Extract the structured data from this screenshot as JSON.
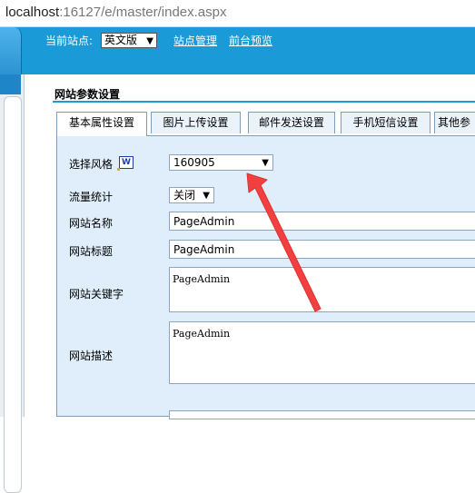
{
  "browser": {
    "host": "localhost",
    "path": ":16127/e/master/index.aspx"
  },
  "topbar": {
    "site_label": "当前站点:",
    "site_value": "英文版",
    "links": [
      "站点管理",
      "前台预览"
    ]
  },
  "panel": {
    "title": "网站参数设置",
    "tabs": [
      "基本属性设置",
      "图片上传设置",
      "邮件发送设置",
      "手机短信设置",
      "其他参"
    ]
  },
  "form": {
    "style_label": "选择风格",
    "style_value": "160905",
    "traffic_label": "流量统计",
    "traffic_value": "关闭",
    "name_label": "网站名称",
    "name_value": "PageAdmin",
    "title_label": "网站标题",
    "title_value": "PageAdmin",
    "keywords_label": "网站关键字",
    "keywords_value": "PageAdmin",
    "desc_label": "网站描述",
    "desc_value": "PageAdmin"
  },
  "colors": {
    "banner": "#1a9ad6",
    "content_bg": "#dfeefa",
    "arrow": "#f0403f"
  },
  "annotation": {
    "type": "red-arrow",
    "points_to": "style-select"
  }
}
